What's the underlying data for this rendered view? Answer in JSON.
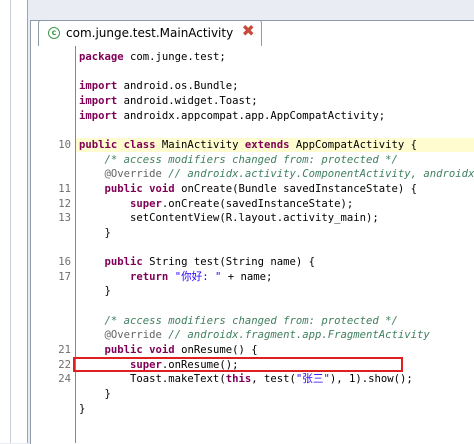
{
  "tab": {
    "title": "com.junge.test.MainActivity",
    "icon": "class-icon",
    "close": "close-icon"
  },
  "colors": {
    "keyword": "#7f0055",
    "comment": "#3f7f5f",
    "string": "#2a00ff",
    "annotation": "#646464",
    "highlight_box": "#e02020",
    "green_line": "#4caf50"
  },
  "code": {
    "lines": [
      {
        "num": "",
        "parts": [
          {
            "t": "kw",
            "v": "package"
          },
          {
            "t": "pl",
            "v": " com.junge.test;"
          }
        ]
      },
      {
        "num": "",
        "parts": []
      },
      {
        "num": "",
        "parts": [
          {
            "t": "kw",
            "v": "import"
          },
          {
            "t": "pl",
            "v": " android.os.Bundle;"
          }
        ]
      },
      {
        "num": "",
        "parts": [
          {
            "t": "kw",
            "v": "import"
          },
          {
            "t": "pl",
            "v": " android.widget.Toast;"
          }
        ]
      },
      {
        "num": "",
        "parts": [
          {
            "t": "kw",
            "v": "import"
          },
          {
            "t": "pl",
            "v": " androidx.appcompat.app.AppCompatActivity;"
          }
        ]
      },
      {
        "num": "",
        "parts": []
      },
      {
        "num": "10",
        "highlight": true,
        "parts": [
          {
            "t": "kw",
            "v": "public class"
          },
          {
            "t": "pl",
            "v": " MainActivity "
          },
          {
            "t": "kw",
            "v": "extends"
          },
          {
            "t": "pl",
            "v": " AppCompatActivity {"
          }
        ]
      },
      {
        "num": "",
        "parts": [
          {
            "t": "pl",
            "v": "    "
          },
          {
            "t": "cm",
            "v": "/* access modifiers changed from: protected */"
          }
        ]
      },
      {
        "num": "",
        "parts": [
          {
            "t": "pl",
            "v": "    "
          },
          {
            "t": "an",
            "v": "@Override"
          },
          {
            "t": "cm",
            "v": " // androidx.activity.ComponentActivity, androidx.co"
          }
        ]
      },
      {
        "num": "11",
        "parts": [
          {
            "t": "pl",
            "v": "    "
          },
          {
            "t": "kw",
            "v": "public void"
          },
          {
            "t": "pl",
            "v": " onCreate(Bundle savedInstanceState) {"
          }
        ]
      },
      {
        "num": "12",
        "parts": [
          {
            "t": "pl",
            "v": "        "
          },
          {
            "t": "kw",
            "v": "super"
          },
          {
            "t": "pl",
            "v": ".onCreate(savedInstanceState);"
          }
        ]
      },
      {
        "num": "13",
        "parts": [
          {
            "t": "pl",
            "v": "        setContentView(R.layout.activity_main);"
          }
        ]
      },
      {
        "num": "",
        "parts": [
          {
            "t": "pl",
            "v": "    }"
          }
        ]
      },
      {
        "num": "",
        "parts": []
      },
      {
        "num": "16",
        "parts": [
          {
            "t": "pl",
            "v": "    "
          },
          {
            "t": "kw",
            "v": "public"
          },
          {
            "t": "pl",
            "v": " String test(String name) {"
          }
        ]
      },
      {
        "num": "17",
        "parts": [
          {
            "t": "pl",
            "v": "        "
          },
          {
            "t": "kw",
            "v": "return"
          },
          {
            "t": "pl",
            "v": " "
          },
          {
            "t": "st",
            "v": "\"你好: \""
          },
          {
            "t": "pl",
            "v": " + name;"
          }
        ]
      },
      {
        "num": "",
        "parts": [
          {
            "t": "pl",
            "v": "    }"
          }
        ]
      },
      {
        "num": "",
        "parts": []
      },
      {
        "num": "",
        "parts": [
          {
            "t": "pl",
            "v": "    "
          },
          {
            "t": "cm",
            "v": "/* access modifiers changed from: protected */"
          }
        ]
      },
      {
        "num": "",
        "parts": [
          {
            "t": "pl",
            "v": "    "
          },
          {
            "t": "an",
            "v": "@Override"
          },
          {
            "t": "cm",
            "v": " // androidx.fragment.app.FragmentActivity"
          }
        ]
      },
      {
        "num": "21",
        "parts": [
          {
            "t": "pl",
            "v": "    "
          },
          {
            "t": "kw",
            "v": "public void"
          },
          {
            "t": "pl",
            "v": " onResume() {"
          }
        ]
      },
      {
        "num": "22",
        "parts": [
          {
            "t": "pl",
            "v": "        "
          },
          {
            "t": "kw",
            "v": "super"
          },
          {
            "t": "pl",
            "v": ".onResume();"
          }
        ]
      },
      {
        "num": "24",
        "parts": [
          {
            "t": "pl",
            "v": "        Toast.makeText("
          },
          {
            "t": "kw",
            "v": "this"
          },
          {
            "t": "pl",
            "v": ", test("
          },
          {
            "t": "st",
            "v": "\"张三\""
          },
          {
            "t": "pl",
            "v": "), 1).show();"
          }
        ]
      },
      {
        "num": "",
        "parts": [
          {
            "t": "pl",
            "v": "    }"
          }
        ]
      },
      {
        "num": "",
        "parts": [
          {
            "t": "pl",
            "v": "}"
          }
        ]
      }
    ]
  }
}
